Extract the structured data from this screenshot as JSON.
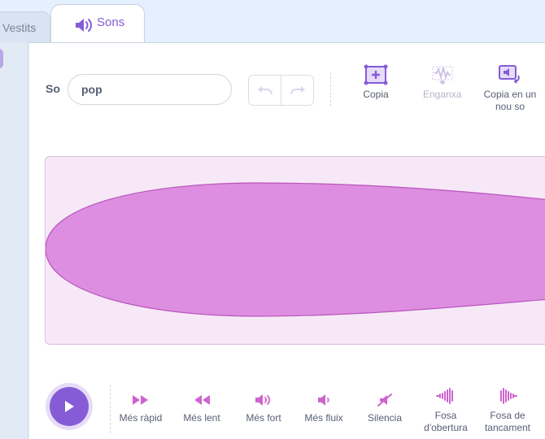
{
  "tabs": [
    {
      "label": "Vestits",
      "active": false
    },
    {
      "label": "Sons",
      "active": true,
      "icon": "speaker-icon"
    }
  ],
  "sound": {
    "name_label": "So",
    "name_value": "pop"
  },
  "toolbar": {
    "copy_label": "Copia",
    "paste_label": "Enganxa",
    "copy_new_label": "Copia en un nou so"
  },
  "effects": {
    "faster": "Més ràpid",
    "slower": "Més lent",
    "louder": "Més fort",
    "softer": "Més fluix",
    "mute": "Silencia",
    "fade_in": "Fosa d'obertura",
    "fade_out": "Fosa de tancament"
  },
  "colors": {
    "accent": "#855cd6",
    "effect_icon": "#cf63cf",
    "waveform_fill": "#dd8ee0",
    "waveform_bg": "#f7e8f7"
  }
}
